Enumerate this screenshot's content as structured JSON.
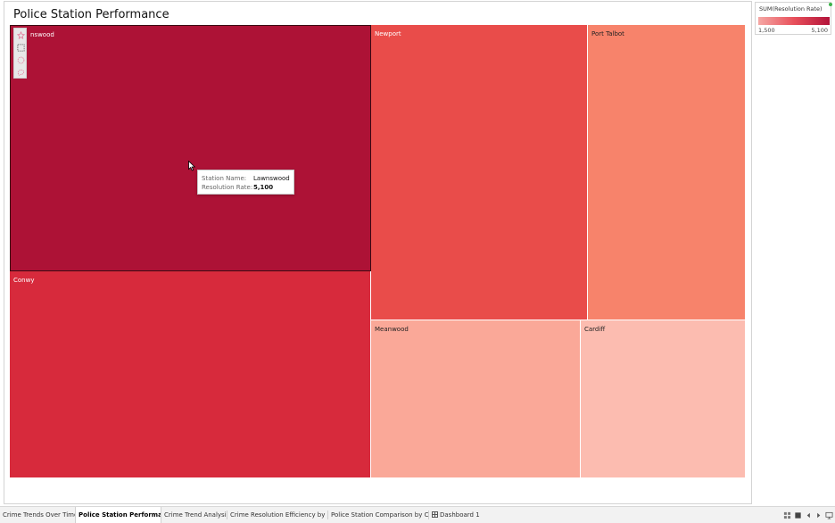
{
  "view": {
    "title": "Police Station Performance"
  },
  "legend": {
    "title": "SUM(Resolution Rate)",
    "min_label": "1,500",
    "max_label": "5,100"
  },
  "chart_data": {
    "type": "treemap",
    "measure": "SUM(Resolution Rate)",
    "items": [
      {
        "name": "Lawnswood",
        "label_visible": "nswood",
        "value": 5100,
        "color": "#ad1236"
      },
      {
        "name": "Conwy",
        "value": null,
        "color": "#d72a3c"
      },
      {
        "name": "Newport",
        "value": null,
        "color": "#e94c4a"
      },
      {
        "name": "Port Talbot",
        "value": null,
        "color": "#f7836b"
      },
      {
        "name": "Meanwood",
        "value": null,
        "color": "#faa898"
      },
      {
        "name": "Cardiff",
        "value": 1500,
        "color": "#fcbcb0"
      }
    ]
  },
  "tooltip": {
    "rows": [
      {
        "key": "Station Name:",
        "value": "Lawnswood"
      },
      {
        "key": "Resolution Rate:",
        "value": "5,100"
      }
    ]
  },
  "toolbar": {
    "tools": [
      {
        "icon": "pin-icon"
      },
      {
        "icon": "rectangle-select-icon"
      },
      {
        "icon": "radial-select-icon"
      },
      {
        "icon": "lasso-select-icon"
      }
    ]
  },
  "tabs": [
    {
      "label": "Crime Trends Over Time",
      "active": false
    },
    {
      "label": "Police Station Performance",
      "active": true
    },
    {
      "label": "Crime Trend Analysis",
      "active": false
    },
    {
      "label": "Crime Resolution Efficiency by R...",
      "active": false
    },
    {
      "label": "Police Station Comparison by Cr...",
      "active": false
    },
    {
      "label": "Dashboard 1",
      "active": false,
      "icon": "dashboard-icon"
    }
  ],
  "nav": [
    {
      "icon": "grid-view-icon"
    },
    {
      "icon": "single-view-icon"
    },
    {
      "icon": "previous-sheet-icon"
    },
    {
      "icon": "next-sheet-icon"
    },
    {
      "icon": "presentation-mode-icon"
    }
  ]
}
